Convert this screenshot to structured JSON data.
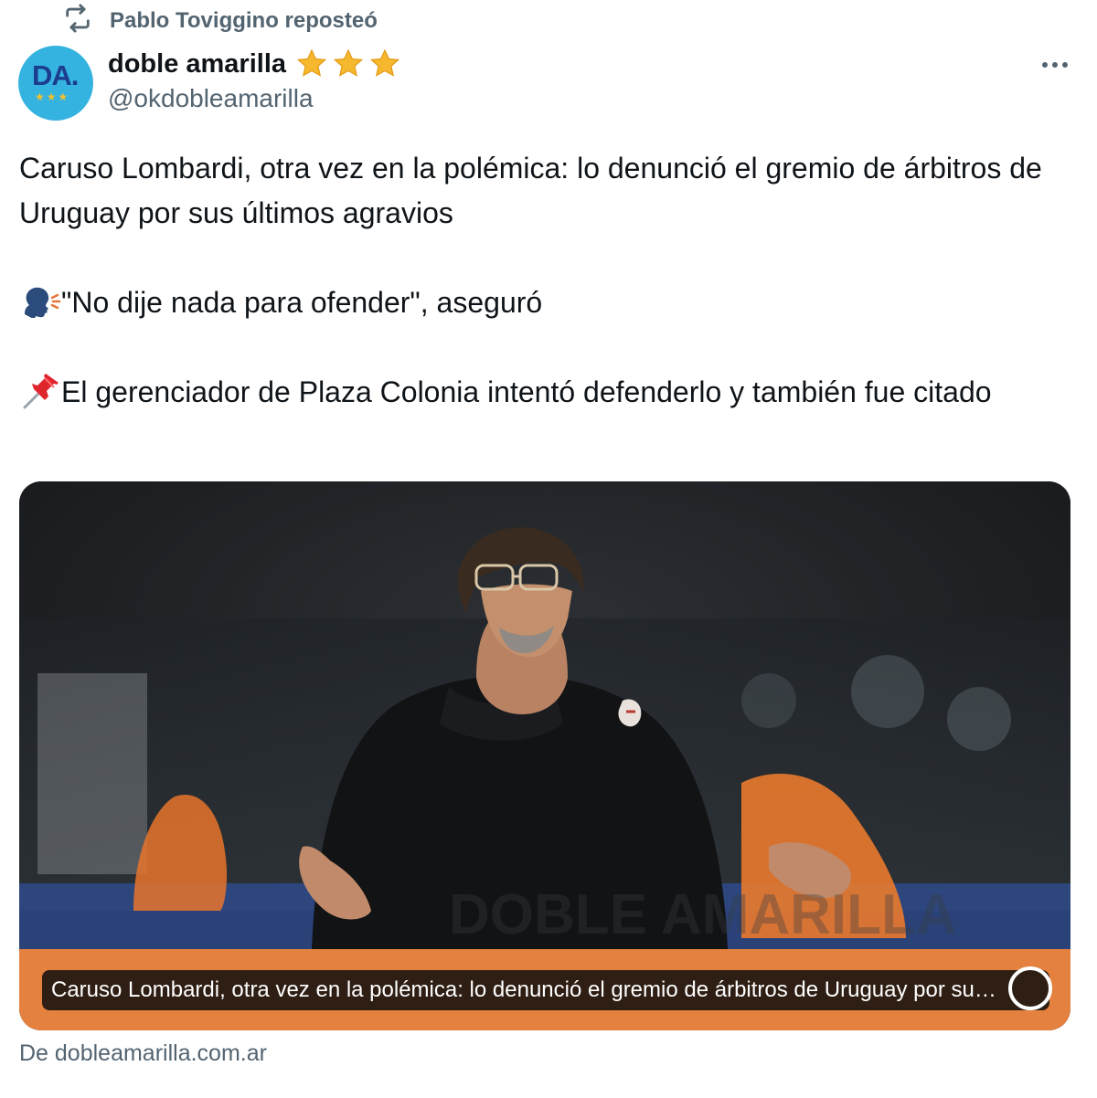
{
  "repost": {
    "icon": "repost-icon",
    "text": "Pablo Toviggino reposteó"
  },
  "author": {
    "avatar_monogram": "DA.",
    "avatar_stars": "★★★",
    "name": "doble amarilla",
    "badge_icon": "three-stars-badge-icon",
    "handle": "@okdobleamarilla"
  },
  "more_icon": "more-dots-icon",
  "tweet": {
    "line1": "Caruso Lombardi, otra vez en la polémica: lo denunció el gremio de árbitros de Uruguay por sus últimos agravios",
    "line2_emoji": "speaking-head-icon",
    "line2": "\"No dije nada para ofender\", aseguró",
    "line3_emoji": "pushpin-icon",
    "line3": "El gerenciador de Plaza Colonia intentó defenderlo y también fue citado"
  },
  "card": {
    "image_description_icon": "coach-photo",
    "caption": "Caruso Lombardi, otra vez en la polémica: lo denunció el gremio de árbitros de Uruguay por sus últimos agravios",
    "source": "De dobleamarilla.com.ar"
  },
  "colors": {
    "text": "#0f1419",
    "muted": "#536471",
    "avatar_bg": "#35b3e0",
    "star": "#f5b82e",
    "card_bar": "#e4813f"
  }
}
